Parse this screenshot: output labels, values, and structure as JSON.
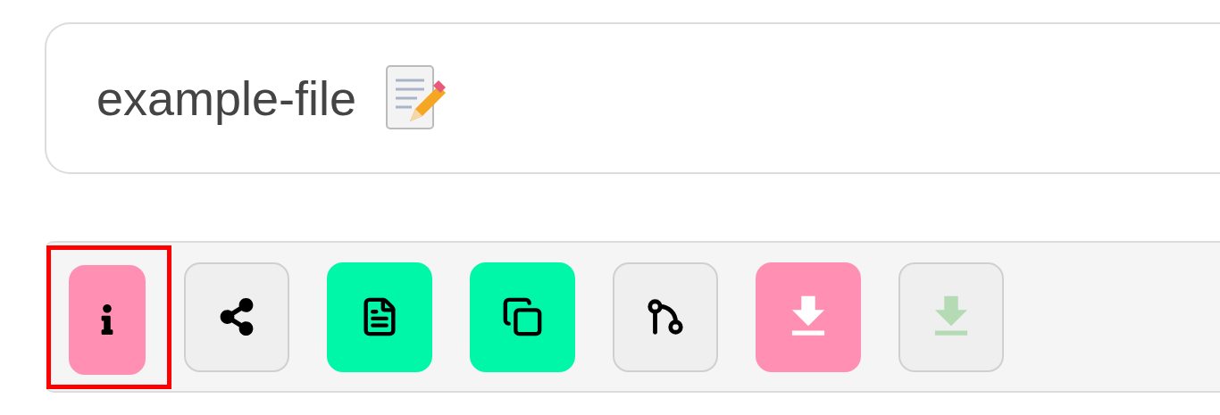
{
  "file_name": {
    "value": "example-file"
  },
  "toolbar": [
    {
      "kind": "info",
      "color": "#ff8fb3",
      "highlighted": true,
      "disabled": false
    },
    {
      "kind": "share",
      "color": "#efefef",
      "highlighted": false,
      "disabled": false
    },
    {
      "kind": "file",
      "color": "#00f7a8",
      "highlighted": false,
      "disabled": false
    },
    {
      "kind": "copy",
      "color": "#00f7a8",
      "highlighted": false,
      "disabled": false
    },
    {
      "kind": "branch",
      "color": "#efefef",
      "highlighted": false,
      "disabled": false
    },
    {
      "kind": "download",
      "color": "#ff8fb3",
      "highlighted": false,
      "disabled": false
    },
    {
      "kind": "download",
      "color": "#efefef",
      "highlighted": false,
      "disabled": true
    }
  ]
}
